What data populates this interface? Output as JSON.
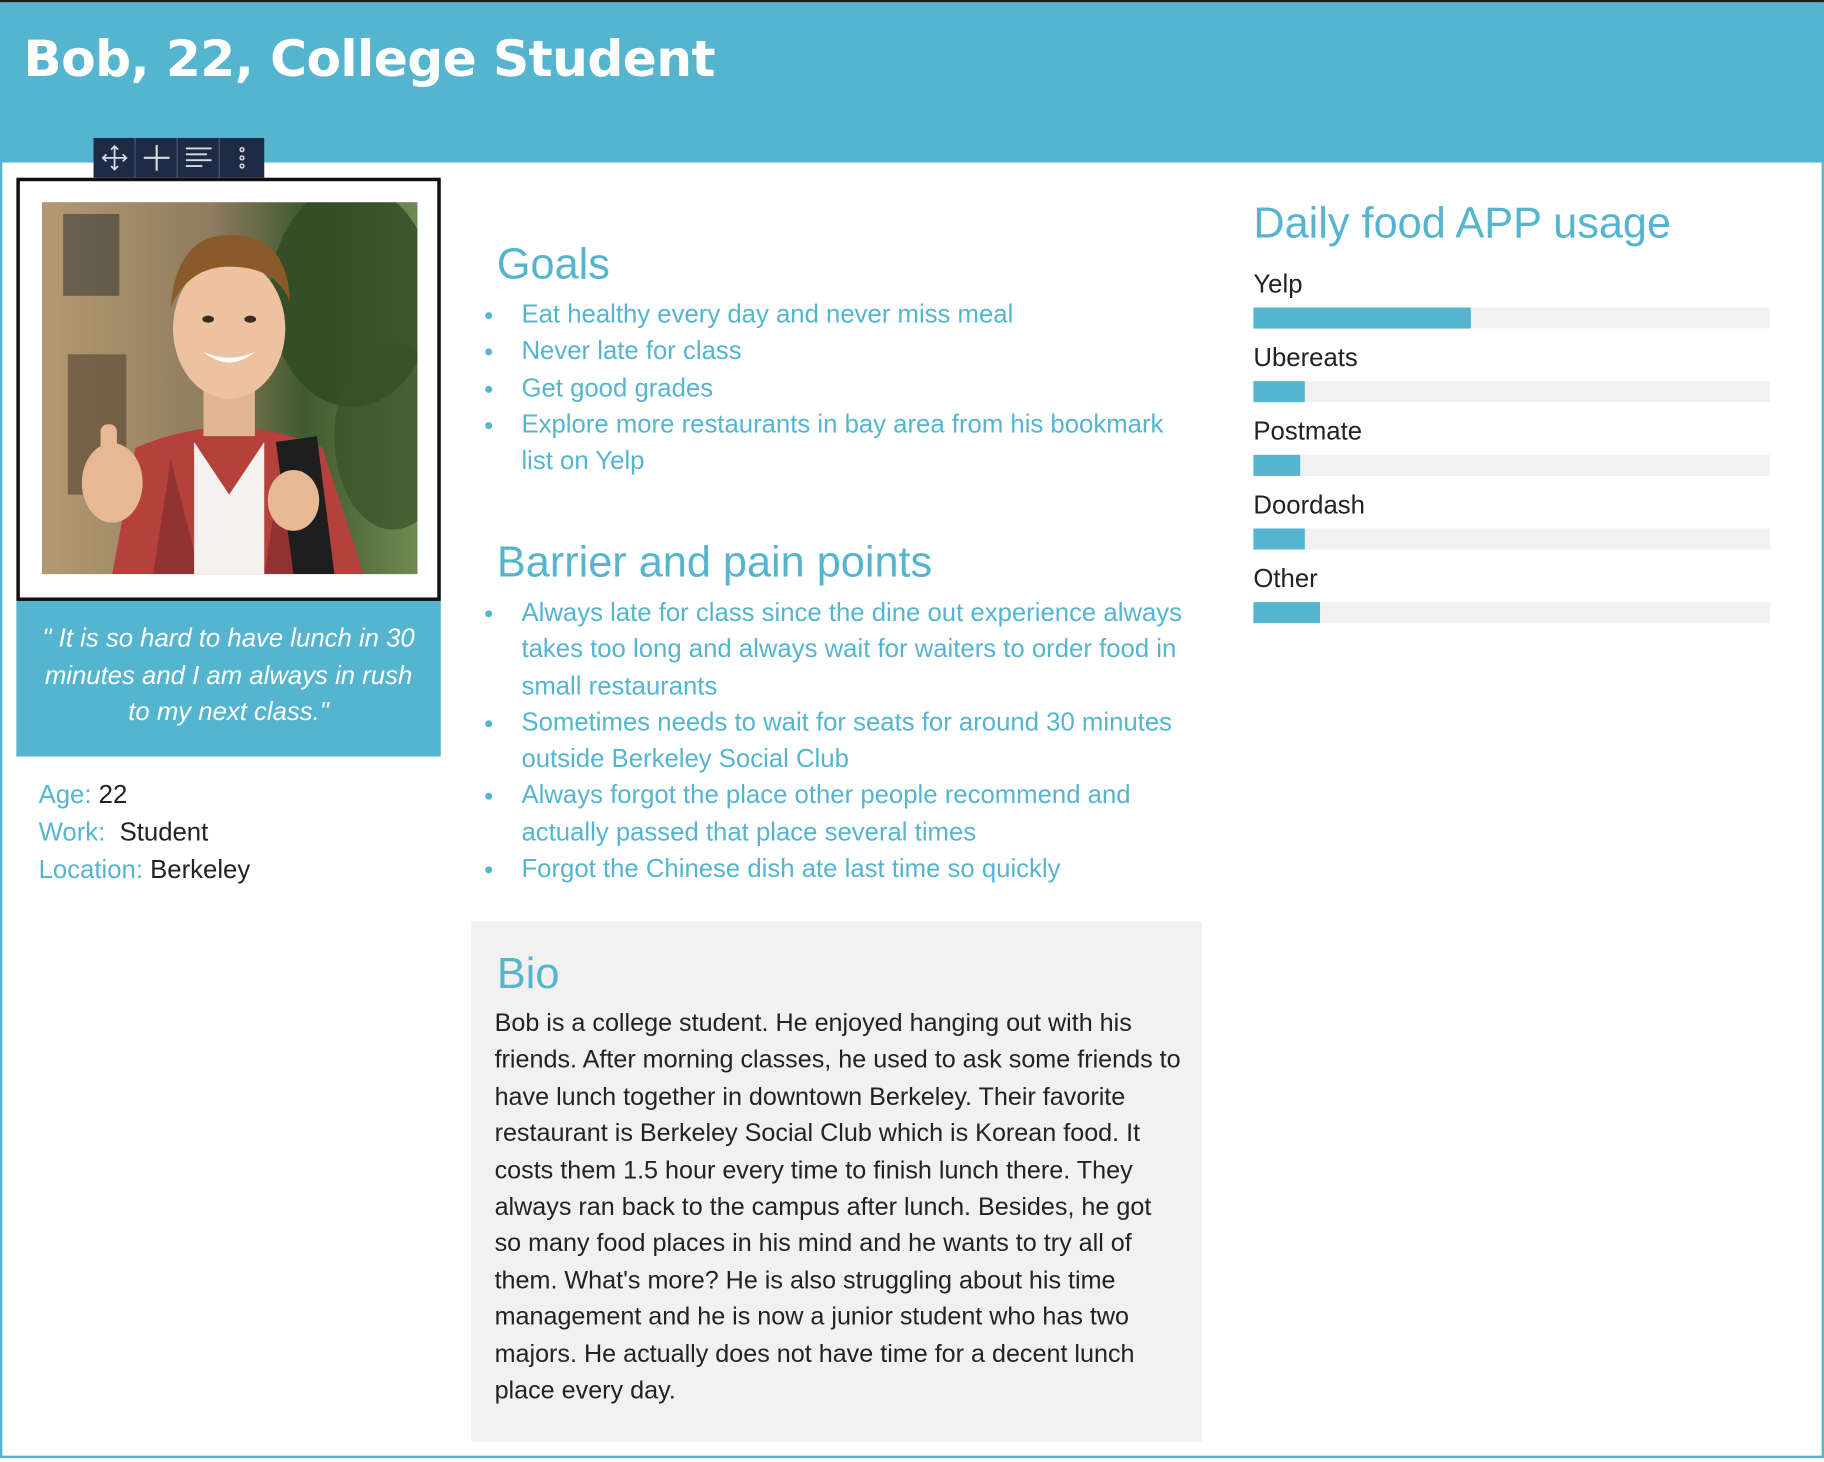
{
  "header": {
    "title": "Bob, 22, College Student"
  },
  "toolbar": {
    "icons": [
      "move-icon",
      "plus-icon",
      "align-icon",
      "more-icon"
    ]
  },
  "persona": {
    "quote": "\" It is so hard to have lunch in 30 minutes and I am always in rush to my next class.\"",
    "facts": [
      {
        "label": "Age:",
        "value": "22"
      },
      {
        "label": "Work:",
        "value": "Student"
      },
      {
        "label": "Location:",
        "value": "Berkeley"
      }
    ]
  },
  "goals": {
    "title": "Goals",
    "items": [
      "Eat healthy every day and never miss meal",
      "Never late for class",
      "Get good grades",
      "Explore more restaurants in bay area from his bookmark list on Yelp"
    ]
  },
  "barriers": {
    "title": "Barrier and pain points",
    "items": [
      "Always late for class since the dine out experience always takes too long and always wait for waiters to order food in small restaurants",
      "Sometimes needs to wait for seats for around 30 minutes outside Berkeley Social Club",
      "Always forgot the place other people recommend and actually passed that place several times",
      "Forgot the Chinese dish ate last time so quickly"
    ]
  },
  "bio": {
    "title": "Bio",
    "text": "Bob is a college student. He enjoyed hanging out with his friends. After morning classes, he used to ask some friends to have lunch together in downtown Berkeley. Their favorite restaurant is Berkeley Social Club which is Korean food. It costs them 1.5 hour every time to finish lunch there. They always ran back to the campus after lunch. Besides, he got so many food places in his mind and he wants to try all of them. What's more? He is also struggling about his time management and he is now a junior student who has two majors. He actually does not have time for a decent lunch place every day."
  },
  "usage": {
    "title": "Daily food APP usage",
    "accent_color": "#55b5cf",
    "track_color": "#f1f1f1",
    "items": [
      {
        "label": "Yelp",
        "fraction": 0.42
      },
      {
        "label": "Ubereats",
        "fraction": 0.1
      },
      {
        "label": "Postmate",
        "fraction": 0.09
      },
      {
        "label": "Doordash",
        "fraction": 0.1
      },
      {
        "label": "Other",
        "fraction": 0.13
      }
    ]
  }
}
